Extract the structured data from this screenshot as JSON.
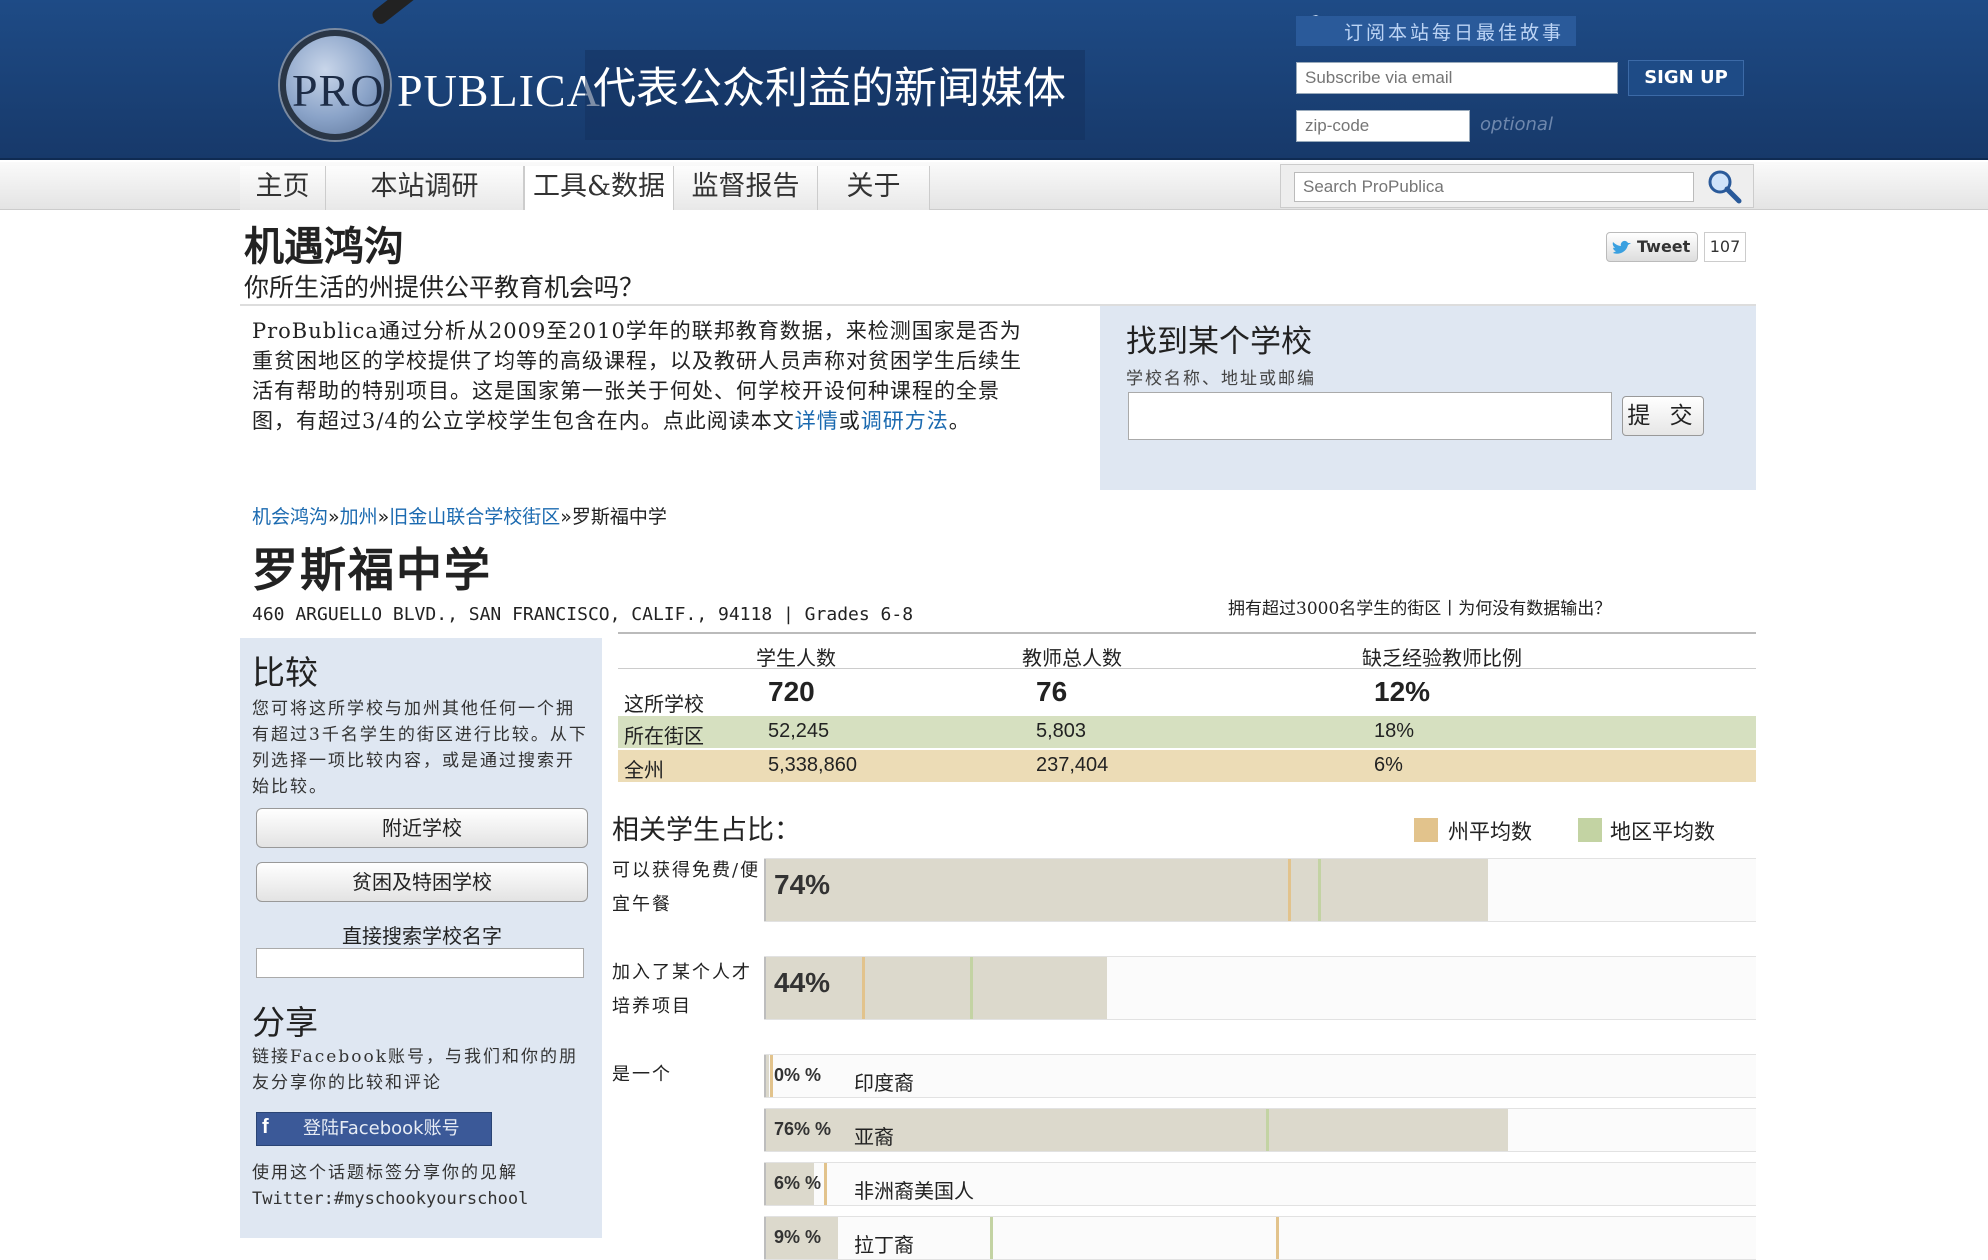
{
  "header": {
    "logo_pro": "PRO",
    "logo_publica": "PUBLICA",
    "tagline": "代表公众利益的新闻媒体",
    "subscribe_banner": "订阅本站每日最佳故事",
    "email_placeholder": "Subscribe via email",
    "signup_label": "SIGN UP",
    "zip_placeholder": "zip-code",
    "optional_label": "optional",
    "colors": {
      "brand": "#1e4b86"
    }
  },
  "nav": {
    "tabs": [
      {
        "label": "主页"
      },
      {
        "label": "本站调研"
      },
      {
        "label": "工具&数据"
      },
      {
        "label": "监督报告"
      },
      {
        "label": "关于"
      }
    ],
    "active_tab": "工具&数据",
    "search_placeholder": "Search ProPublica"
  },
  "page": {
    "title": "机遇鸿沟",
    "subtitle": "你所生活的州提供公平教育机会吗？",
    "tweet_label": "Tweet",
    "tweet_count": "107",
    "intro": "ProBublica通过分析从2009至2010学年的联邦教育数据，来检测国家是否为重贫困地区的学校提供了均等的高级课程，以及教研人员声称对贫困学生后续生活有帮助的特别项目。这是国家第一张关于何处、何学校开设何种课程的全景图，有超过3/4的公立学校学生包含在内。点此阅读本文",
    "intro_link1": "详情",
    "intro_or": "或",
    "intro_link2": "调研方法",
    "intro_end": "。"
  },
  "finder": {
    "title": "找到某个学校",
    "label": "学校名称、地址或邮编",
    "submit": "提 交"
  },
  "breadcrumb": {
    "items": [
      "机会鸿沟",
      "加州",
      "旧金山联合学校街区"
    ],
    "separator": "»",
    "current": "罗斯福中学"
  },
  "school": {
    "name": "罗斯福中学",
    "address": "460 ARGUELLO BLVD., SAN FRANCISCO, CALIF., 94118 | Grades 6-8",
    "district_note": "拥有超过3000名学生的街区丨为何没有数据输出？"
  },
  "sidebar": {
    "compare_title": "比较",
    "compare_text": "您可将这所学校与加州其他任何一个拥有超过3千名学生的街区进行比较。从下列选择一项比较内容，或是通过搜索开始比较。",
    "nearby_button": "附近学校",
    "poverty_button": "贫困及特困学校",
    "search_label": "直接搜索学校名字",
    "share_title": "分享",
    "share_text": "链接Facebook账号，与我们和你的朋友分享你的比较和评论",
    "facebook_button": "登陆Facebook账号",
    "twitter_text": "使用这个话题标签分享你的见解",
    "twitter_tag": "Twitter:#myschookyourschool"
  },
  "stats": {
    "headers": [
      "学生人数",
      "教师总人数",
      "缺乏经验教师比例"
    ],
    "rows": [
      {
        "label": "这所学校",
        "values": [
          "720",
          "76",
          "12%"
        ]
      },
      {
        "label": "所在街区",
        "values": [
          "52,245",
          "5,803",
          "18%"
        ]
      },
      {
        "label": "全州",
        "values": [
          "5,338,860",
          "237,404",
          "6%"
        ]
      }
    ],
    "colors": {
      "district": "#d6e0c0",
      "state": "#ecdcb6"
    }
  },
  "related": {
    "title": "相关学生占比：",
    "legend_state": "州平均数",
    "legend_region": "地区平均数",
    "colors": {
      "state": "#e2c38c",
      "region": "#c3d3a3",
      "fill": "#dcd9cc"
    },
    "lunch_label": "可以获得免费/便宜午餐",
    "lunch_pct": "74%",
    "gifted_label": "加入了某个人才培养项目",
    "gifted_pct": "44%",
    "ethnicity_label": "是一个",
    "ethnicities": [
      {
        "pct": "0% %",
        "name": "印度裔"
      },
      {
        "pct": "76% %",
        "name": "亚裔"
      },
      {
        "pct": "6% %",
        "name": "非洲裔美国人"
      },
      {
        "pct": "9% %",
        "name": "拉丁裔"
      }
    ]
  }
}
